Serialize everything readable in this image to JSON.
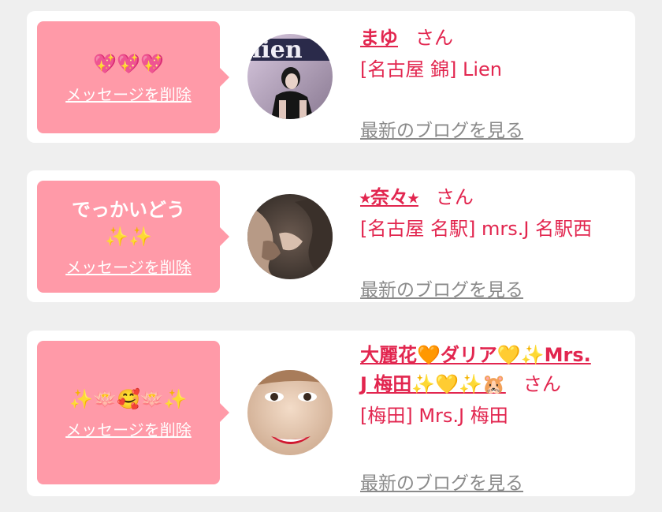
{
  "colors": {
    "background": "#efefef",
    "card": "#ffffff",
    "bubble": "#ff9aa8",
    "accent": "#e2264f",
    "link_gray": "#8a8a8a"
  },
  "common": {
    "delete_label": "メッセージを削除",
    "blog_label": "最新のブログを見る",
    "honorific": "さん"
  },
  "cards": [
    {
      "message_lines": [
        "💖💖💖"
      ],
      "avatar": "girl-photo-lien",
      "name": "まゆ",
      "shop": "[名古屋 錦] Lien"
    },
    {
      "message_lines": [
        "でっかいどう",
        "✨✨"
      ],
      "avatar": "girl-photo-hair",
      "name": "⭑奈々⭑",
      "shop": "[名古屋 名駅] mrs.J 名駅西"
    },
    {
      "message_lines": [
        "✨🪷🥰🪷✨"
      ],
      "avatar": "girl-photo-smile",
      "name_line1": "大麗花🧡ダリア💛✨Mrs.",
      "name_line2": "J 梅田✨💛✨🐹",
      "shop": "[梅田] Mrs.J 梅田"
    }
  ]
}
